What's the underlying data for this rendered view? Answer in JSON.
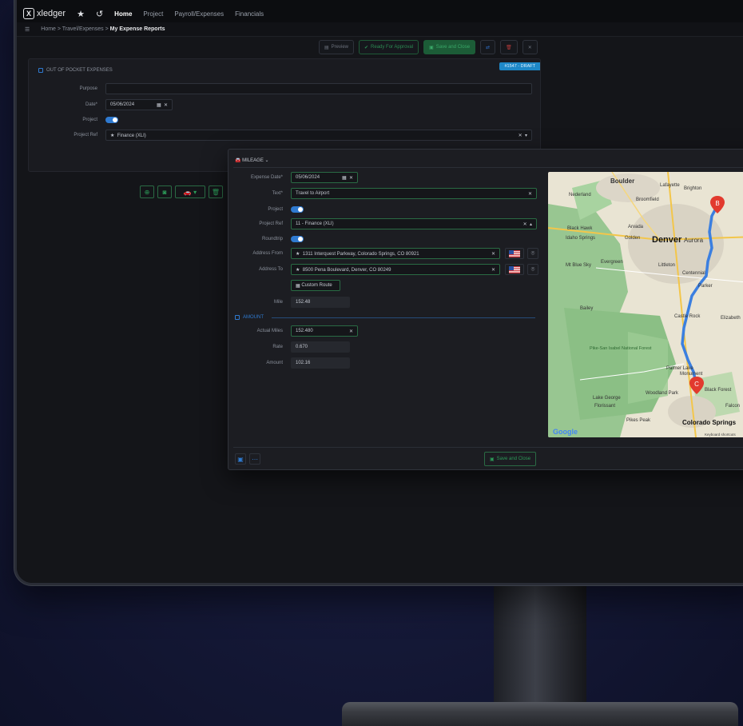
{
  "nav": {
    "logo_text": "xledger",
    "links": [
      "Home",
      "Project",
      "Payroll/Expenses",
      "Financials"
    ]
  },
  "breadcrumb": {
    "path": "Home > Travel/Expenses > ",
    "current": "My Expense Reports"
  },
  "toolbar": {
    "preview": "Preview",
    "ready_approval": "Ready For Approval",
    "save_close": "Save and Close"
  },
  "expense_report": {
    "section_title": "OUT OF POCKET EXPENSES",
    "badge": "#1547 - DRAFT",
    "purpose_label": "Purpose",
    "purpose_value": "",
    "date_label": "Date*",
    "date_value": "05/06/2024",
    "project_label": "Project",
    "project_ref_label": "Project Ref",
    "project_ref_value": "Finance (XLI)"
  },
  "mileage": {
    "title": "MILEAGE",
    "expense_date_label": "Expense Date*",
    "expense_date_value": "05/06/2024",
    "text_label": "Text*",
    "text_value": "Travel to Airport",
    "project_label": "Project",
    "project_ref_label": "Project Ref",
    "project_ref_value": "11 - Finance (XLI)",
    "roundtrip_label": "Roundtrip",
    "address_from_label": "Address From",
    "address_from_value": "1311 Interquest Parkway, Colorado Springs, CO 80921",
    "address_to_label": "Address To",
    "address_to_value": "8500 Pena Boulevard, Denver, CO 80249",
    "custom_route": "Custom Route",
    "mile_label": "Mile",
    "mile_value": "152.48",
    "amount_title": "AMOUNT",
    "actual_miles_label": "Actual Miles",
    "actual_miles_value": "152.480",
    "rate_label": "Rate",
    "rate_value": "0.670",
    "amount_label": "Amount",
    "amount_value": "102.16",
    "save_close": "Save and Close"
  },
  "map": {
    "places": [
      "Boulder",
      "Lafayette",
      "Brighton",
      "Nederland",
      "Broomfield",
      "Black Hawk",
      "Arvada",
      "Idaho Springs",
      "Golden",
      "Denver",
      "Aurora",
      "Mt Blue Sky",
      "Evergreen",
      "Littleton",
      "Centennial",
      "Parker",
      "Bailey",
      "Castle Rock",
      "Elizabeth",
      "Pike-San Isabel National Forest",
      "Palmer Lake",
      "Monument",
      "Black Forest",
      "Lake George",
      "Florissant",
      "Woodland Park",
      "Falcon",
      "Pikes Peak",
      "Colorado Springs"
    ],
    "marker_a": "B",
    "marker_b": "C",
    "google": "Google",
    "shortcuts": "Keyboard shortcuts"
  },
  "colors": {
    "accent": "#2f7ad0",
    "green": "#2c9a58",
    "badge": "#1e88c7",
    "route": "#3b7fe0",
    "marker": "#e23a2e"
  }
}
